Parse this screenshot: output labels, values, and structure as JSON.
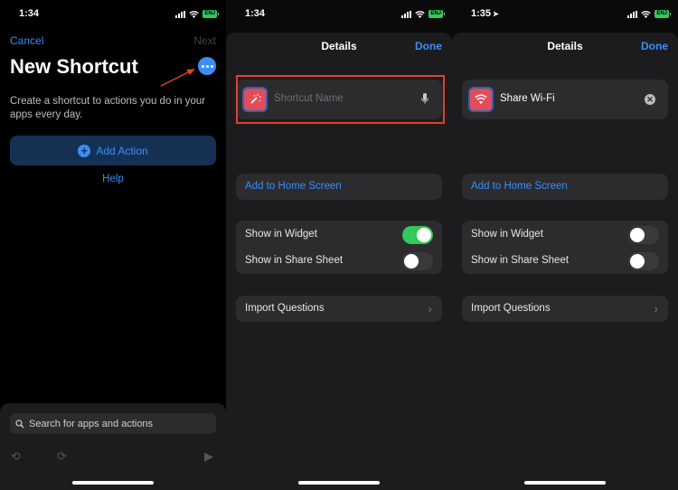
{
  "panel1": {
    "time": "1:34",
    "battery": "ENJ",
    "cancel": "Cancel",
    "next": "Next",
    "title": "New Shortcut",
    "description": "Create a shortcut to actions you do in your apps every day.",
    "add_action": "Add Action",
    "help": "Help",
    "search_placeholder": "Search for apps and actions"
  },
  "panel2": {
    "time": "1:34",
    "battery": "ENJ",
    "title": "Details",
    "done": "Done",
    "name_placeholder": "Shortcut Name",
    "add_home": "Add to Home Screen",
    "show_widget": "Show in Widget",
    "show_widget_on": true,
    "show_share": "Show in Share Sheet",
    "show_share_on": false,
    "import_questions": "Import Questions"
  },
  "panel3": {
    "time": "1:35",
    "battery": "ENJ",
    "title": "Details",
    "done": "Done",
    "name_value": "Share Wi-Fi",
    "add_home": "Add to Home Screen",
    "show_widget": "Show in Widget",
    "show_widget_on": false,
    "show_share": "Show in Share Sheet",
    "show_share_on": false,
    "import_questions": "Import Questions"
  },
  "colors": {
    "accent": "#3a8ef6",
    "toggle_on": "#34c759",
    "icon_bg": "#e04e5a",
    "highlight": "#e0402f"
  }
}
